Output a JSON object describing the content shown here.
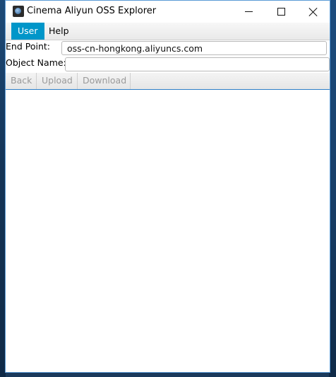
{
  "window": {
    "title": "Cinema Aliyun OSS Explorer"
  },
  "menu": {
    "items": [
      {
        "label": "User"
      },
      {
        "label": "Help"
      }
    ]
  },
  "form": {
    "endpoint_label": "End Point:",
    "endpoint_value": "oss-cn-hongkong.aliyuncs.com",
    "object_label": "Object Name:",
    "object_value": ""
  },
  "toolbar": {
    "back_label": "Back",
    "upload_label": "Upload",
    "download_label": "Download"
  },
  "colors": {
    "menu_selected": "#0096c9",
    "window_border": "#5b9bd5"
  }
}
